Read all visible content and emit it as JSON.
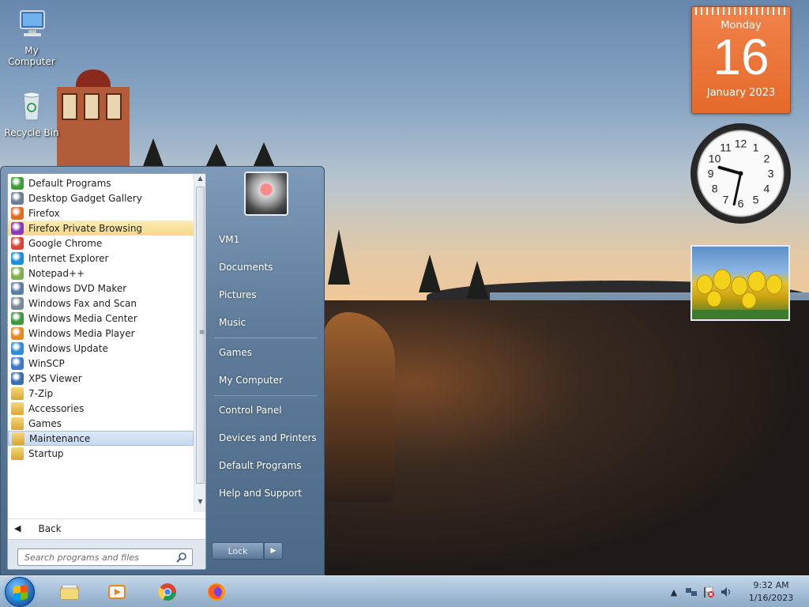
{
  "desktop": {
    "icons": [
      {
        "label": "My Computer",
        "icon": "computer-icon"
      },
      {
        "label": "Recycle Bin",
        "icon": "recycle-bin-icon"
      }
    ]
  },
  "gadgets": {
    "calendar": {
      "day": "Monday",
      "date": "16",
      "month_year": "January 2023"
    },
    "clock": {
      "time": "9:32",
      "numbers": [
        "12",
        "1",
        "2",
        "3",
        "4",
        "5",
        "6",
        "7",
        "8",
        "9",
        "10",
        "11"
      ]
    },
    "slideshow": {
      "icon": "tulips-photo"
    }
  },
  "start_menu": {
    "programs": [
      {
        "label": "Default Programs",
        "icon": "default-programs-icon",
        "color": "#3c9d3a"
      },
      {
        "label": "Desktop Gadget Gallery",
        "icon": "gadget-gallery-icon",
        "color": "#6b7f93"
      },
      {
        "label": "Firefox",
        "icon": "firefox-icon",
        "color": "#e66b1f"
      },
      {
        "label": "Firefox Private Browsing",
        "icon": "firefox-private-icon",
        "color": "#8a3ab9",
        "state": "highlighted"
      },
      {
        "label": "Google Chrome",
        "icon": "chrome-icon",
        "color": "#db4437"
      },
      {
        "label": "Internet Explorer",
        "icon": "internet-explorer-icon",
        "color": "#1a8ee0"
      },
      {
        "label": "Notepad++",
        "icon": "notepad-plus-plus-icon",
        "color": "#7fb04a"
      },
      {
        "label": "Windows DVD Maker",
        "icon": "dvd-maker-icon",
        "color": "#5a7ea8"
      },
      {
        "label": "Windows Fax and Scan",
        "icon": "fax-scan-icon",
        "color": "#7a8a99"
      },
      {
        "label": "Windows Media Center",
        "icon": "media-center-icon",
        "color": "#3b9b3b"
      },
      {
        "label": "Windows Media Player",
        "icon": "media-player-icon",
        "color": "#e8871e"
      },
      {
        "label": "Windows Update",
        "icon": "windows-update-icon",
        "color": "#2f8bd4"
      },
      {
        "label": "WinSCP",
        "icon": "winscp-icon",
        "color": "#3c7bc9"
      },
      {
        "label": "XPS Viewer",
        "icon": "xps-viewer-icon",
        "color": "#3a6fb5"
      },
      {
        "label": "7-Zip",
        "icon": "folder-icon",
        "color": "#e0b440"
      },
      {
        "label": "Accessories",
        "icon": "folder-icon",
        "color": "#e0b440"
      },
      {
        "label": "Games",
        "icon": "folder-icon",
        "color": "#e0b440"
      },
      {
        "label": "Maintenance",
        "icon": "folder-icon",
        "color": "#e0b440",
        "state": "selected"
      },
      {
        "label": "Startup",
        "icon": "folder-icon",
        "color": "#e0b440"
      }
    ],
    "back_label": "Back",
    "search_placeholder": "Search programs and files",
    "right_items": [
      {
        "label": "VM1"
      },
      {
        "label": "Documents"
      },
      {
        "label": "Pictures"
      },
      {
        "label": "Music"
      },
      {
        "label": "Games"
      },
      {
        "label": "My Computer"
      },
      {
        "label": "Control Panel"
      },
      {
        "label": "Devices and Printers"
      },
      {
        "label": "Default Programs"
      },
      {
        "label": "Help and Support"
      }
    ],
    "shutdown_label": "Lock"
  },
  "taskbar": {
    "pinned": [
      {
        "name": "Windows Explorer",
        "icon": "explorer-icon"
      },
      {
        "name": "Windows Media Player",
        "icon": "media-player-icon"
      },
      {
        "name": "Google Chrome",
        "icon": "chrome-icon"
      },
      {
        "name": "Firefox",
        "icon": "firefox-icon"
      }
    ],
    "tray": {
      "time": "9:32 AM",
      "date": "1/16/2023"
    }
  },
  "colors": {
    "accent": "#e56a2a",
    "highlight": "#f6d989",
    "selection": "#c5daf0"
  }
}
